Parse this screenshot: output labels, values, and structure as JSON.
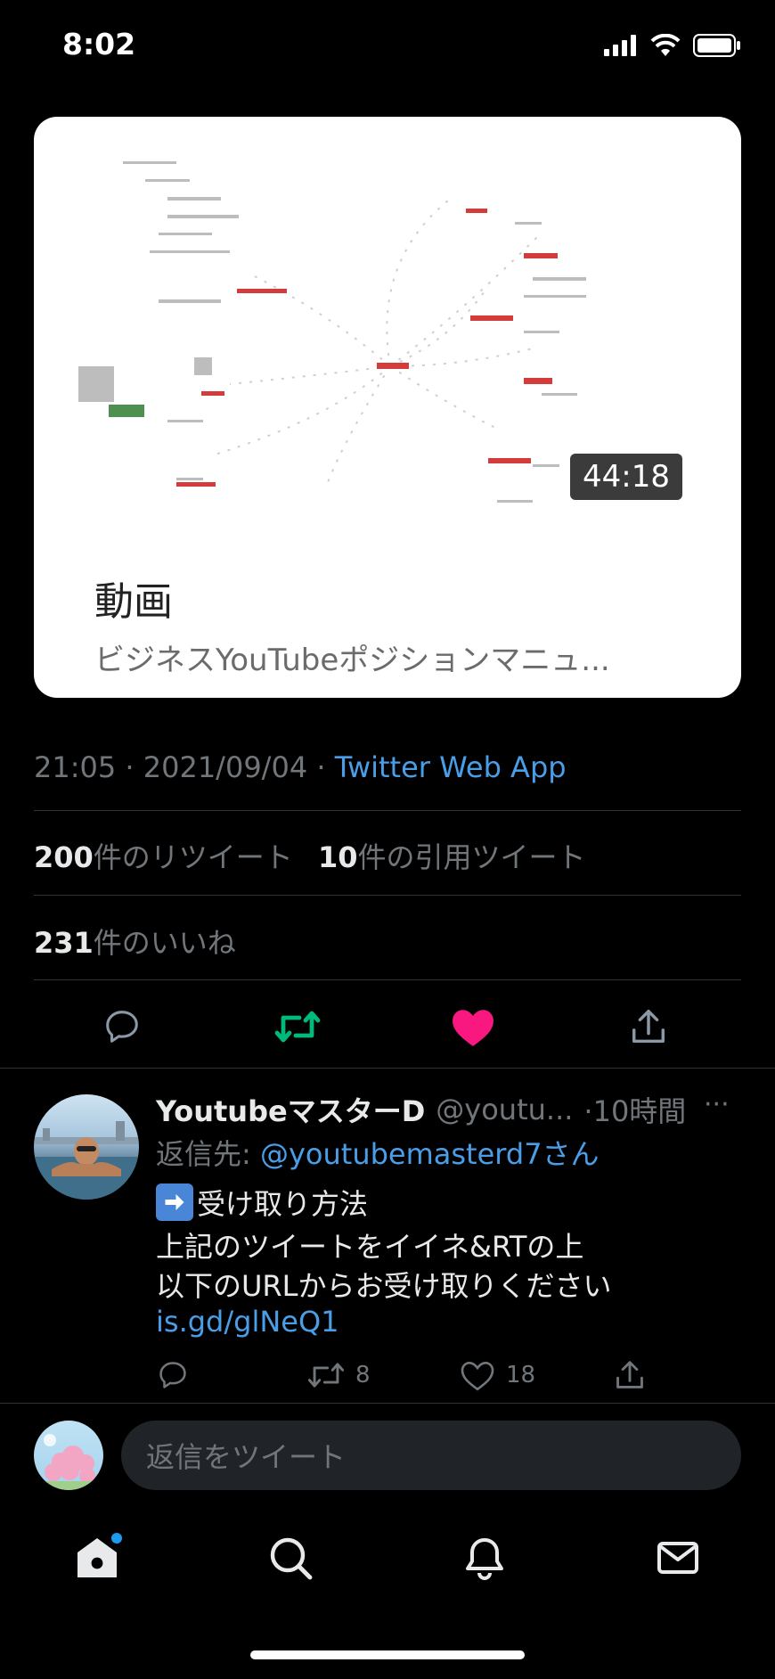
{
  "status_bar": {
    "time": "8:02"
  },
  "media_card": {
    "duration": "44:18",
    "title": "動画",
    "subtitle": "ビジネスYouTubeポジションマニュ..."
  },
  "tweet": {
    "timestamp": "21:05 · 2021/09/04 · ",
    "source": "Twitter Web App",
    "retweet_count": "200",
    "retweet_label": "件のリツイート",
    "quote_count": "10",
    "quote_label": "件の引用ツイート",
    "like_count": "231",
    "like_label": "件のいいね",
    "icons": [
      "reply-icon",
      "retweet-icon",
      "like-icon-filled",
      "share-icon"
    ],
    "colors": {
      "retweet": "#00ba7c",
      "like": "#f91880",
      "link": "#4a9ee8"
    }
  },
  "reply": {
    "name": "YoutubeマスターD",
    "handle": "@youtu...",
    "time": "·10時間",
    "more": "···",
    "reply_to_prefix": "返信先: ",
    "reply_to_handle": "@youtubemasterd7さん",
    "lines": [
      "受け取り方法",
      "上記のツイートをイイネ&RTの上",
      "以下のURLからお受け取りください"
    ],
    "link": "is.gd/glNeQ1",
    "retweets": "8",
    "likes": "18"
  },
  "compose": {
    "placeholder": "返信をツイート"
  },
  "tab_bar": {
    "items": [
      "home-icon",
      "search-icon",
      "notifications-icon",
      "messages-icon"
    ]
  }
}
